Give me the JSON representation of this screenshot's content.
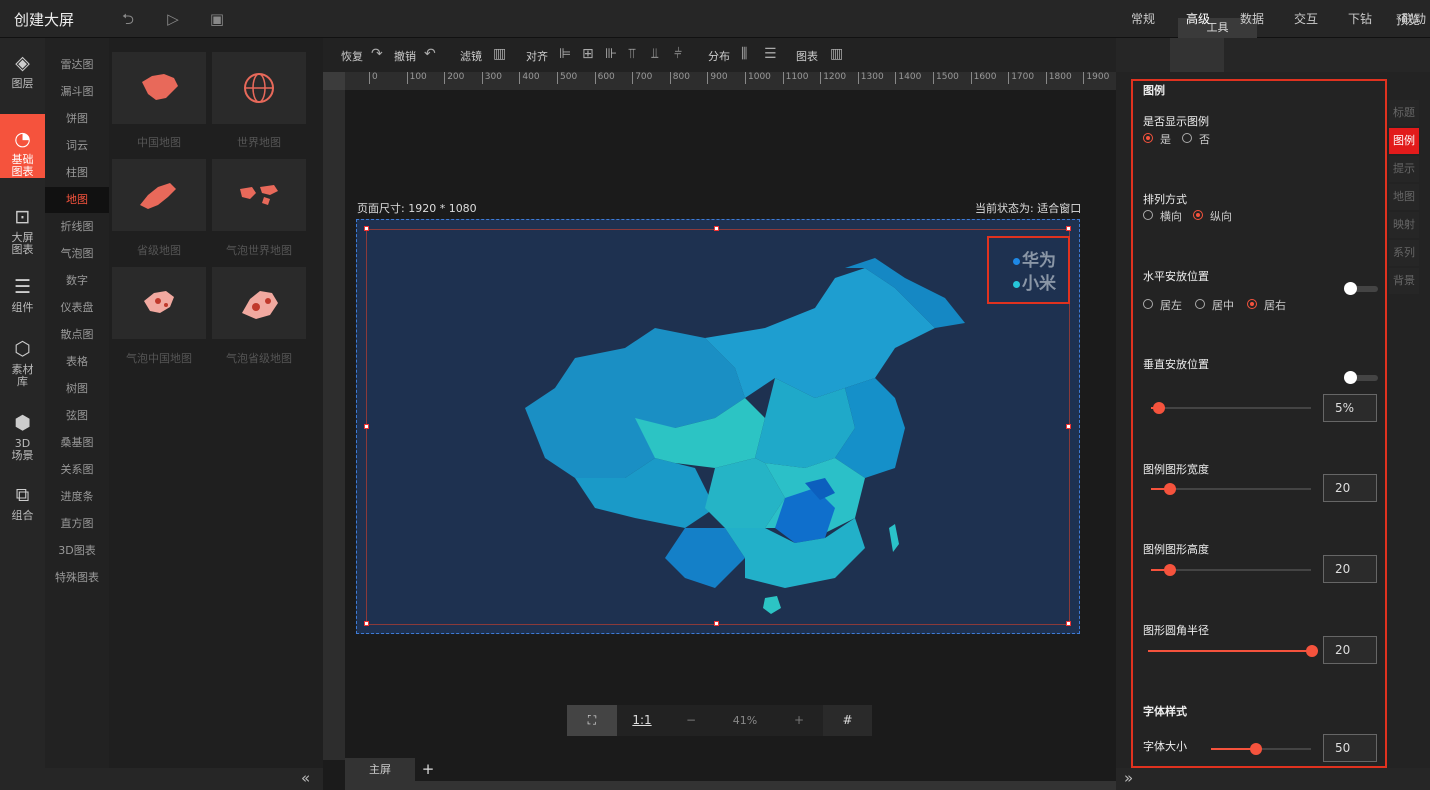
{
  "header": {
    "title": "创建大屏",
    "preview": "预览",
    "tools_tab": "工具"
  },
  "leftnav": [
    {
      "icon": "layers-icon",
      "label": "图层"
    },
    {
      "icon": "chart-pie-icon",
      "label": "基础图表",
      "active": true
    },
    {
      "icon": "screen-icon",
      "label": "大屏图表"
    },
    {
      "icon": "sliders-icon",
      "label": "组件"
    },
    {
      "icon": "hexagons-icon",
      "label": "素材库"
    },
    {
      "icon": "cube-icon",
      "label": "3D场景"
    },
    {
      "icon": "combine-icon",
      "label": "组合"
    }
  ],
  "categories": [
    "雷达图",
    "漏斗图",
    "饼图",
    "词云",
    "柱图",
    "地图",
    "折线图",
    "气泡图",
    "数字",
    "仪表盘",
    "散点图",
    "表格",
    "树图",
    "弦图",
    "桑基图",
    "关系图",
    "进度条",
    "直方图",
    "3D图表",
    "特殊图表"
  ],
  "active_category": "地图",
  "thumbs": [
    "中国地图",
    "世界地图",
    "省级地图",
    "气泡世界地图",
    "气泡中国地图",
    "气泡省级地图"
  ],
  "toolbar": {
    "redo": "恢复",
    "undo": "撤销",
    "filter": "滤镜",
    "align": "对齐",
    "distribute": "分布",
    "chart": "图表"
  },
  "ruler_ticks": [
    "0",
    "100",
    "200",
    "300",
    "400",
    "500",
    "600",
    "700",
    "800",
    "900",
    "1000",
    "1100",
    "1200",
    "1300",
    "1400",
    "1500",
    "1600",
    "1700",
    "1800",
    "1900"
  ],
  "canvas": {
    "page_size": "页面尺寸: 1920 * 1080",
    "current_state": "当前状态为: 适合窗口"
  },
  "legend": [
    {
      "name": "华为",
      "color": "#1e88e5"
    },
    {
      "name": "小米",
      "color": "#26c6da"
    }
  ],
  "zoom": {
    "ratio_label": "1:1",
    "minus": "−",
    "value": "41%",
    "plus": "+"
  },
  "tabs": {
    "main": "主屏",
    "add": "+"
  },
  "right_tabs": [
    "常规",
    "高级",
    "数据",
    "交互",
    "下钻",
    "联动"
  ],
  "right_tab_active": "高级",
  "side_tabs": [
    "标题",
    "图例",
    "提示",
    "地图",
    "映射",
    "系列",
    "背景"
  ],
  "side_tab_active": "图例",
  "panel": {
    "section_title": "图例",
    "show_legend": {
      "label": "是否显示图例",
      "options": [
        "是",
        "否"
      ],
      "selected": "是"
    },
    "orient": {
      "label": "排列方式",
      "options": [
        "横向",
        "纵向"
      ],
      "selected": "纵向"
    },
    "h_position": {
      "label": "水平安放位置",
      "options": [
        "居左",
        "居中",
        "居右"
      ],
      "selected": "居右",
      "toggle": false
    },
    "v_position": {
      "label": "垂直安放位置",
      "toggle": false,
      "value": "5%",
      "slider": 0.05
    },
    "icon_width": {
      "label": "图例图形宽度",
      "value": "20",
      "slider": 0.12
    },
    "icon_height": {
      "label": "图例图形高度",
      "value": "20",
      "slider": 0.12
    },
    "radius": {
      "label": "图形圆角半径",
      "value": "20",
      "slider": 1.0
    },
    "font_section": "字体样式",
    "font_size": {
      "label": "字体大小",
      "value": "50",
      "slider": 0.45
    }
  }
}
